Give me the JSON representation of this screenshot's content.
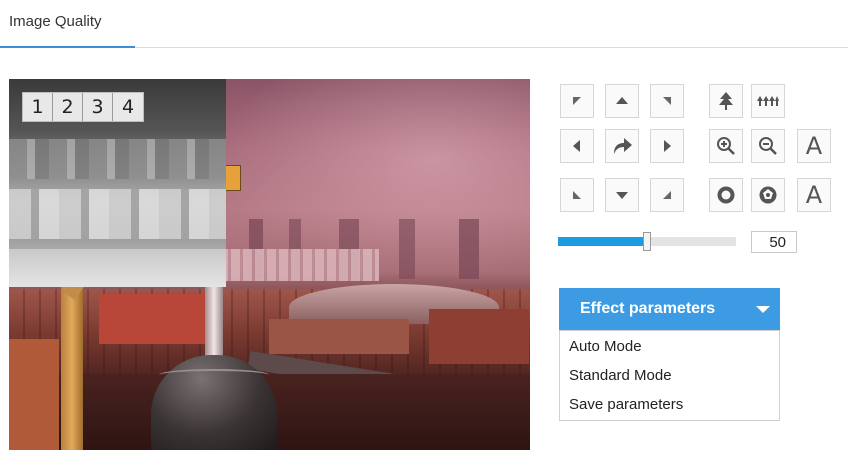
{
  "tabs": [
    {
      "label": "Image Quality",
      "active": true
    }
  ],
  "video": {
    "pip_channels": [
      "1",
      "2",
      "3",
      "4"
    ]
  },
  "ptz": {
    "pan_tilt": [
      {
        "name": "up-left",
        "icon": "arrow-up-left-icon"
      },
      {
        "name": "up",
        "icon": "arrow-up-icon"
      },
      {
        "name": "up-right",
        "icon": "arrow-up-right-icon"
      },
      {
        "name": "left",
        "icon": "arrow-left-icon"
      },
      {
        "name": "auto-rotate",
        "icon": "redo-arrow-icon"
      },
      {
        "name": "right",
        "icon": "arrow-right-icon"
      },
      {
        "name": "down-left",
        "icon": "arrow-down-left-icon"
      },
      {
        "name": "down",
        "icon": "arrow-down-icon"
      },
      {
        "name": "down-right",
        "icon": "arrow-down-right-icon"
      }
    ],
    "lens": [
      {
        "name": "zoom-wide",
        "icon": "tree-icon"
      },
      {
        "name": "zoom-tele",
        "icon": "forest-icon"
      },
      {
        "name": "zoom-in",
        "icon": "zoom-in-icon"
      },
      {
        "name": "zoom-out",
        "icon": "zoom-out-icon"
      },
      {
        "name": "focus-auto-1",
        "icon": "letter-a-icon",
        "text": "A"
      },
      {
        "name": "iris-open",
        "icon": "aperture-open-icon"
      },
      {
        "name": "iris-close",
        "icon": "aperture-close-icon"
      },
      {
        "name": "focus-auto-2",
        "icon": "letter-a-icon",
        "text": "A"
      }
    ],
    "speed": {
      "value": "50",
      "fraction": 0.5
    }
  },
  "effect": {
    "header_label": "Effect parameters",
    "items": [
      "Auto Mode",
      "Standard Mode",
      "Save parameters"
    ]
  },
  "colors": {
    "accent": "#3c9be3",
    "slider_fill": "#1b9be0",
    "tab_underline": "#3c8fd6"
  }
}
